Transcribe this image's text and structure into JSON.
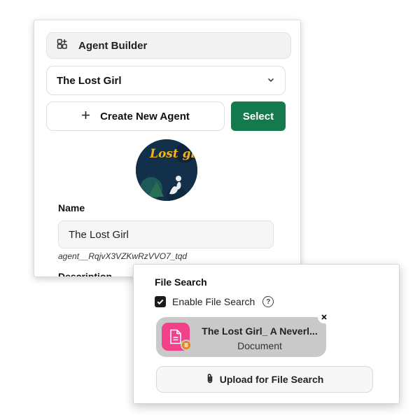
{
  "builder": {
    "label": "Agent Builder",
    "icon": "grid-plus-icon"
  },
  "agent_select": {
    "value": "The Lost Girl",
    "icon": "chevron-down-icon"
  },
  "actions": {
    "create_label": "Create New Agent",
    "create_icon": "plus-icon",
    "select_label": "Select",
    "select_color": "#147a4d"
  },
  "avatar": {
    "title": "Lost girl"
  },
  "form": {
    "name_label": "Name",
    "name_value": "The Lost Girl",
    "agent_id": "agent__RqjvX3VZKwRzVVO7_tqd",
    "description_label": "Description"
  },
  "file_search": {
    "title": "File Search",
    "enable_label": "Enable File Search",
    "enabled": true,
    "help_icon": "question-circle-icon",
    "file": {
      "name": "The Lost Girl_ A Neverl...",
      "type": "Document",
      "icon_color": "#f2408a"
    },
    "upload_label": "Upload for File Search",
    "upload_icon": "paperclip-icon"
  }
}
